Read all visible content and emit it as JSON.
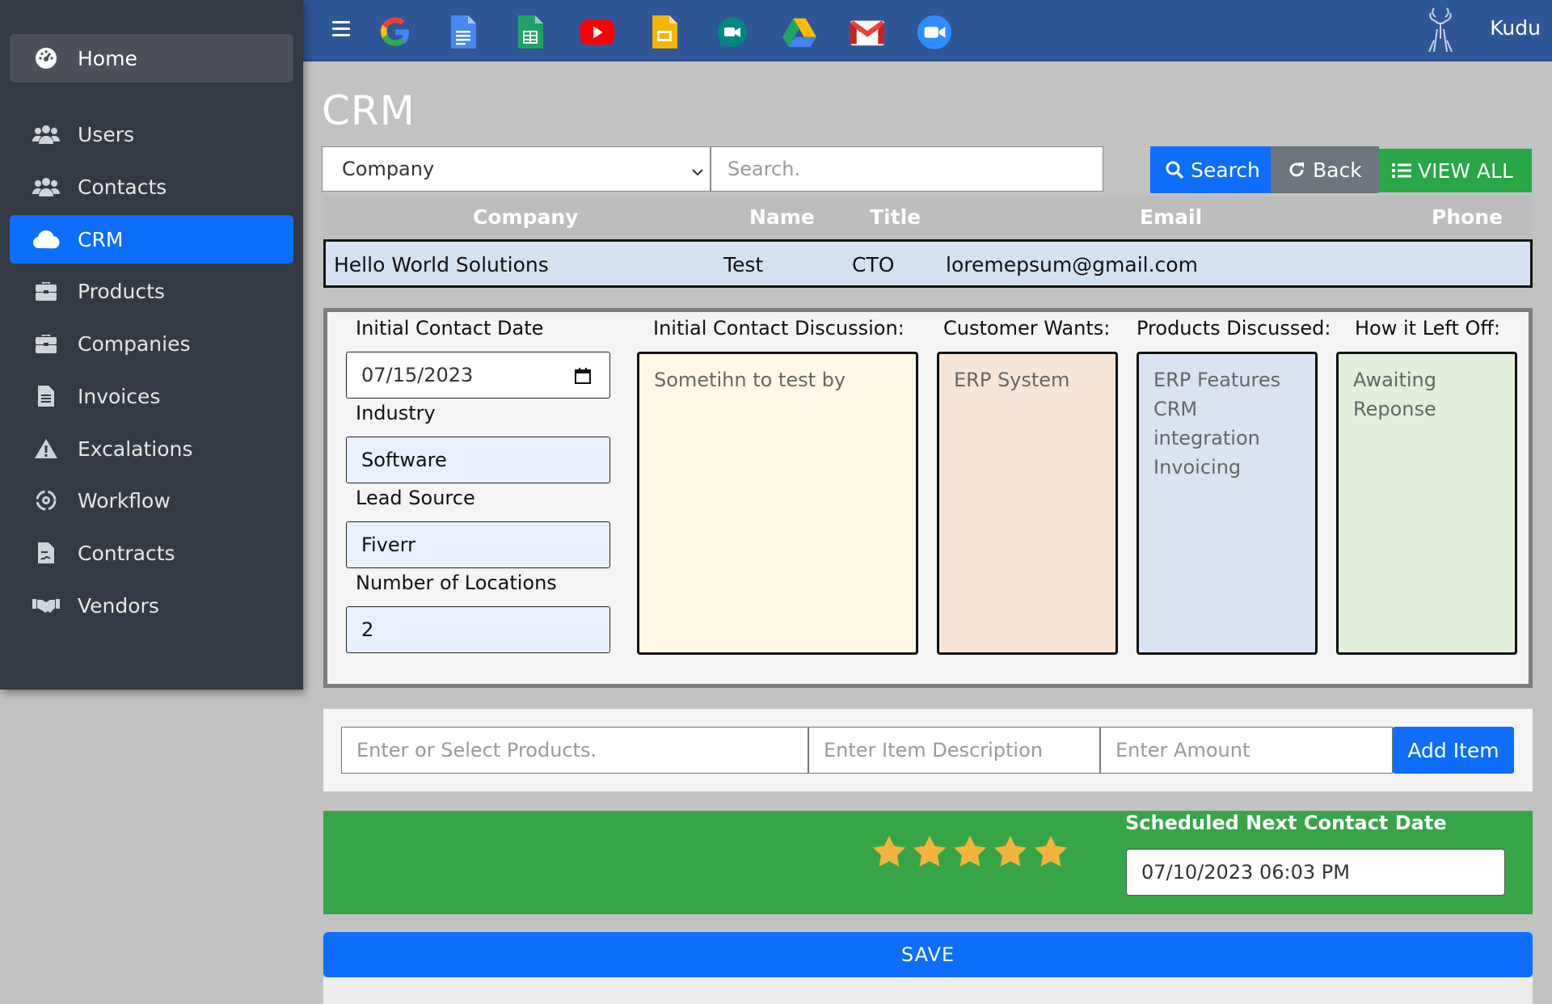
{
  "sidebar": {
    "home": {
      "label": "Home",
      "icon": "dashboard-icon"
    },
    "items": [
      {
        "label": "Users",
        "icon": "users-icon"
      },
      {
        "label": "Contacts",
        "icon": "contacts-icon"
      },
      {
        "label": "CRM",
        "icon": "cloud-icon",
        "active": true
      },
      {
        "label": "Products",
        "icon": "briefcase-icon"
      },
      {
        "label": "Companies",
        "icon": "briefcase-icon"
      },
      {
        "label": "Invoices",
        "icon": "document-icon"
      },
      {
        "label": "Excalations",
        "icon": "warning-icon"
      },
      {
        "label": "Workflow",
        "icon": "gear-cycle-icon"
      },
      {
        "label": "Contracts",
        "icon": "contract-icon"
      },
      {
        "label": "Vendors",
        "icon": "handshake-icon"
      }
    ]
  },
  "topbar": {
    "apps": [
      "google-icon",
      "docs-icon",
      "sheets-icon",
      "youtube-icon",
      "slides-icon",
      "meet-icon",
      "drive-icon",
      "gmail-icon",
      "zoom-icon"
    ],
    "brand": "Kudu"
  },
  "page": {
    "title": "CRM"
  },
  "search": {
    "filter_selected": "Company",
    "placeholder": "Search.",
    "search_label": "Search",
    "back_label": "Back",
    "viewall_label": "VIEW ALL"
  },
  "table": {
    "headers": {
      "company": "Company",
      "name": "Name",
      "title": "Title",
      "email": "Email",
      "phone": "Phone"
    },
    "row": {
      "company": "Hello World Solutions",
      "name": "Test",
      "title": "CTO",
      "email": "loremepsum@gmail.com",
      "phone": ""
    }
  },
  "details": {
    "initial_contact_date_label": "Initial Contact Date",
    "initial_contact_date": "07/15/2023",
    "industry_label": "Industry",
    "industry": "Software",
    "lead_source_label": "Lead Source",
    "lead_source": "Fiverr",
    "locations_label": "Number of Locations",
    "locations": "2",
    "discussion_label": "Initial Contact Discussion:",
    "discussion": "Sometihn to test by",
    "wants_label": "Customer Wants:",
    "wants": "ERP System",
    "products_label": "Products Discussed:",
    "products_lines": [
      "ERP Features",
      "CRM",
      "integration",
      "Invoicing"
    ],
    "leftoff_label": "How it Left Off:",
    "leftoff_lines": [
      "Awaiting",
      "Reponse"
    ]
  },
  "items": {
    "product_placeholder": "Enter or Select Products.",
    "description_placeholder": "Enter Item Description",
    "amount_placeholder": "Enter Amount",
    "add_label": "Add Item"
  },
  "rating": {
    "stars": 5,
    "max": 5,
    "color": "#f4b43c"
  },
  "schedule": {
    "label": "Scheduled Next Contact Date",
    "value": "07/10/2023 06:03 PM"
  },
  "save_label": "SAVE",
  "colors": {
    "primary": "#0d6efd",
    "sidebar": "#343a45",
    "topbar": "#2f5697",
    "success": "#36a547"
  }
}
